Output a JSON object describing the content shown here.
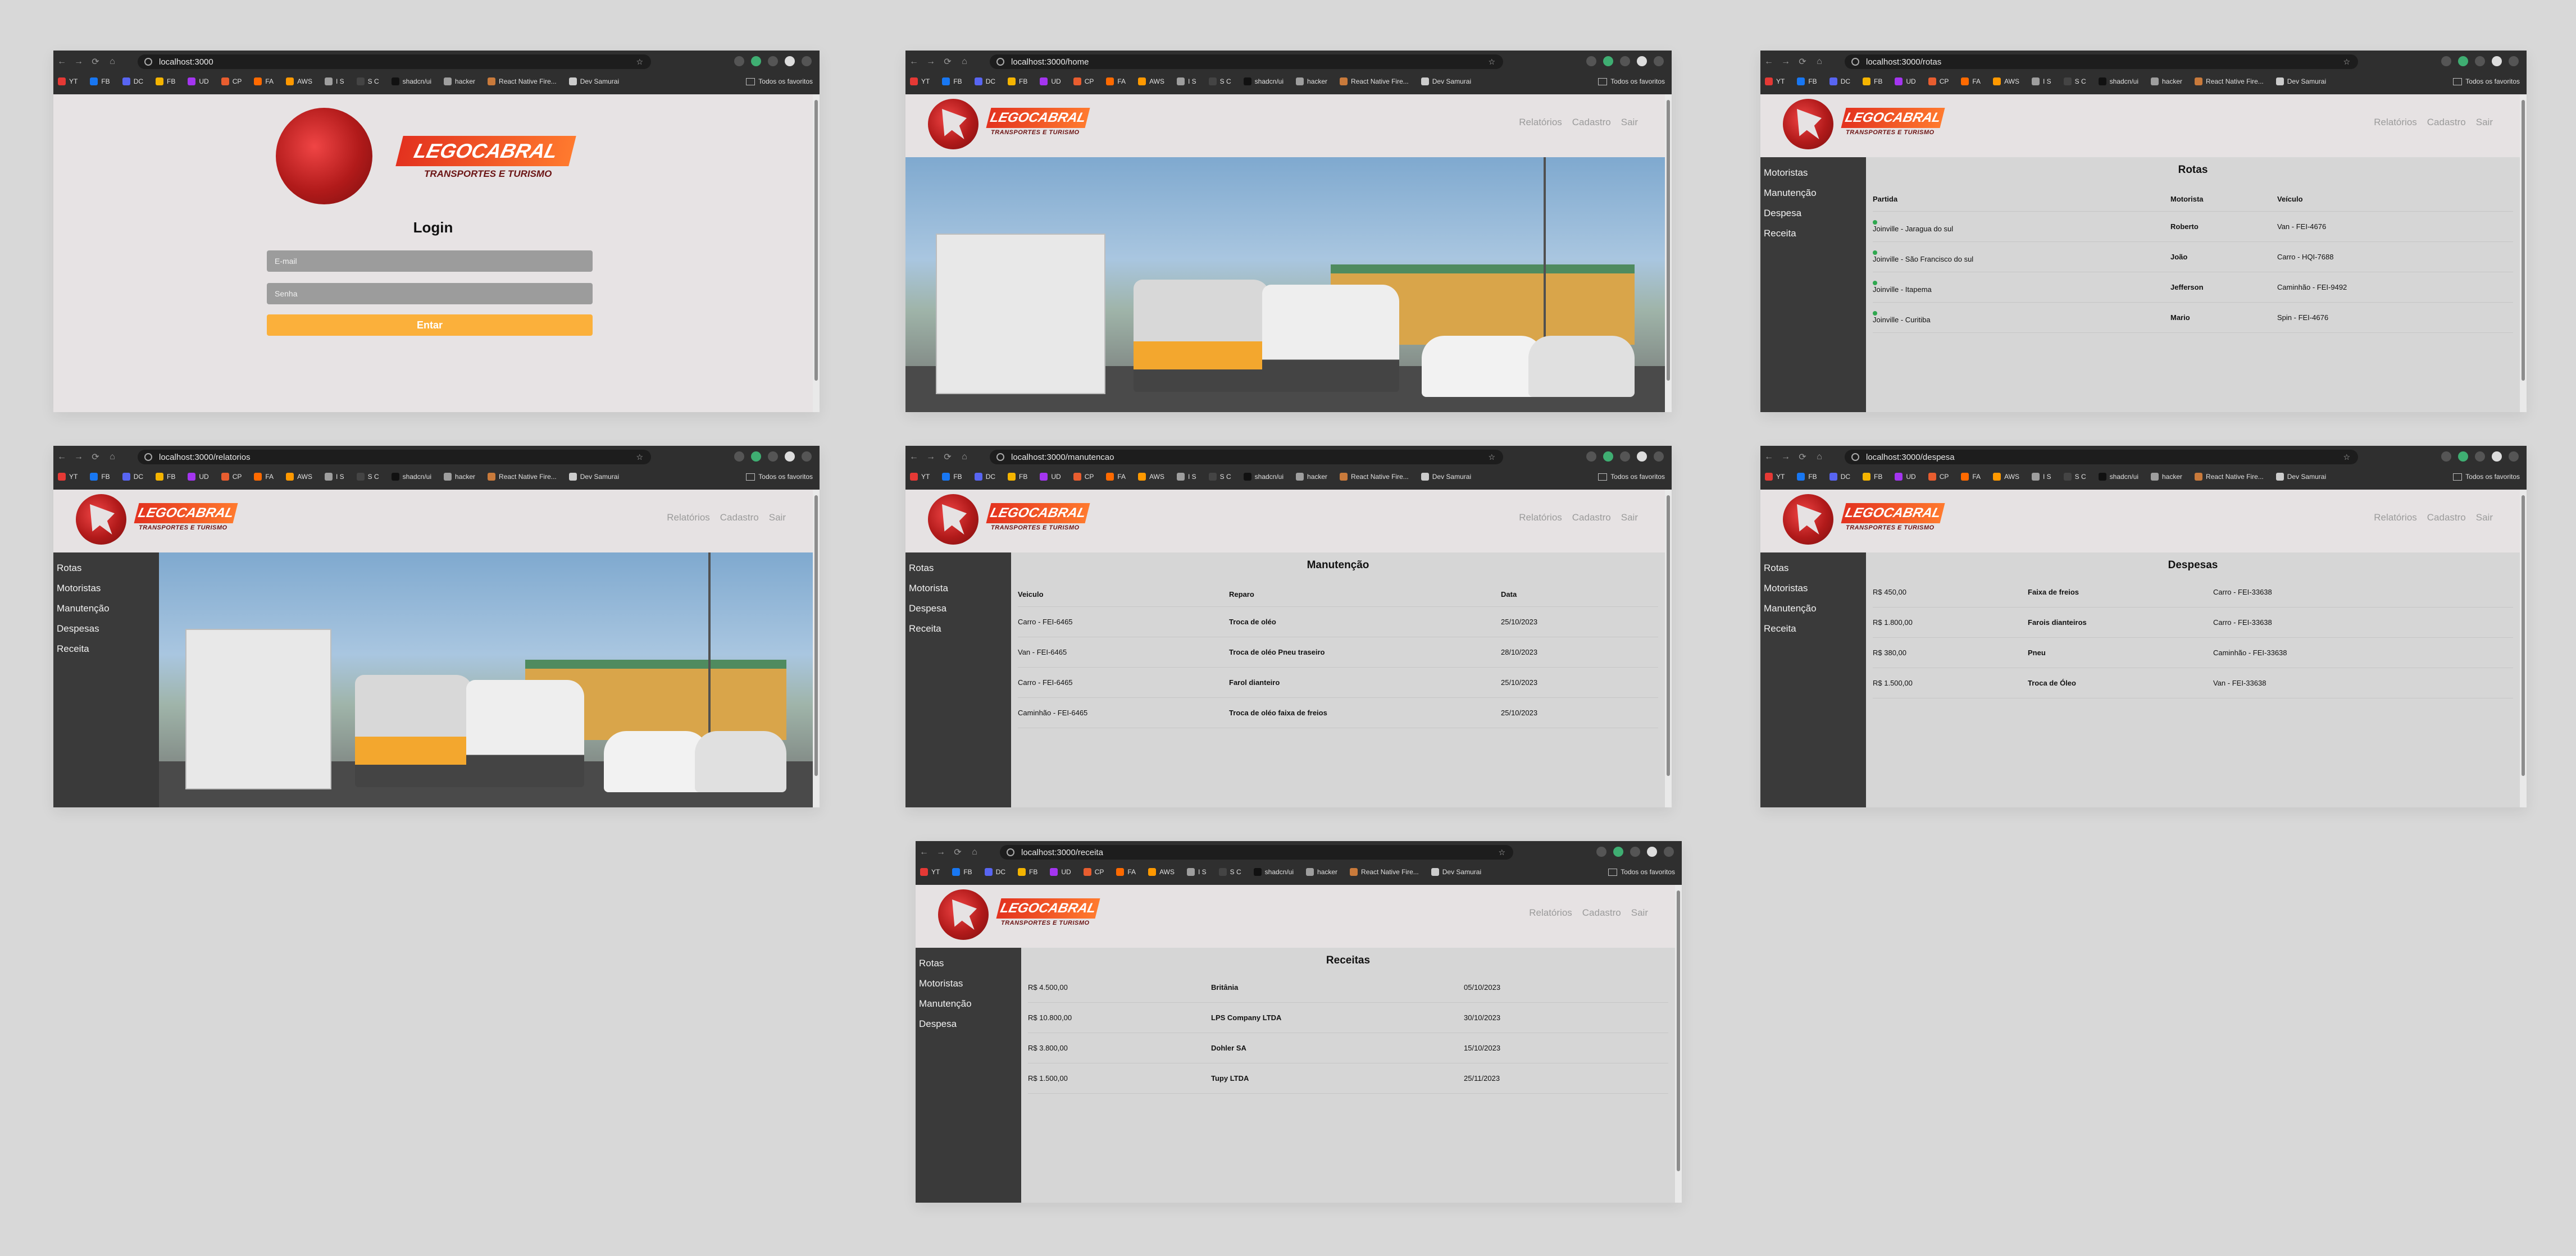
{
  "bookmarks": [
    {
      "label": "YT",
      "color": "#e53935"
    },
    {
      "label": "FB",
      "color": "#1877f2"
    },
    {
      "label": "DC",
      "color": "#5865f2"
    },
    {
      "label": "FB",
      "color": "#f4b400"
    },
    {
      "label": "UD",
      "color": "#a435f0"
    },
    {
      "label": "CP",
      "color": "#e85d2f"
    },
    {
      "label": "FA",
      "color": "#ff6a00"
    },
    {
      "label": "AWS",
      "color": "#ff9900"
    },
    {
      "label": "I S",
      "color": "#9e9e9e"
    },
    {
      "label": "S C",
      "color": "#444444"
    },
    {
      "label": "shadcn/ui",
      "color": "#111111"
    },
    {
      "label": "hacker",
      "color": "#9e9e9e"
    },
    {
      "label": "React Native Fire...",
      "color": "#c97a3b"
    },
    {
      "label": "Dev Samurai",
      "color": "#cccccc"
    }
  ],
  "all_bookmarks": "Todos os favoritos",
  "brand": {
    "name": "LEGOCABRAL",
    "tagline": "TRANSPORTES E TURISMO"
  },
  "nav": {
    "relatorios": "Relatórios",
    "cadastro": "Cadastro",
    "sair": "Sair"
  },
  "windows": {
    "login": {
      "url": "localhost:3000",
      "title": "Login",
      "email_placeholder": "E-mail",
      "password_placeholder": "Senha",
      "submit": "Entar"
    },
    "home": {
      "url": "localhost:3000/home"
    },
    "rotas": {
      "url": "localhost:3000/rotas",
      "menu": [
        "Motoristas",
        "Manutenção",
        "Despesa",
        "Receita"
      ],
      "title": "Rotas",
      "headers": [
        "Partida",
        "Motorista",
        "Veículo"
      ],
      "rows": [
        [
          "Joinville - Jaragua do sul",
          "Roberto",
          "Van - FEI-4676"
        ],
        [
          "Joinville - São Francisco do sul",
          "João",
          "Carro - HQI-7688"
        ],
        [
          "Joinville - Itapema",
          "Jefferson",
          "Caminhão - FEI-9492"
        ],
        [
          "Joinville - Curitiba",
          "Mario",
          "Spin - FEI-4676"
        ]
      ]
    },
    "relatorios": {
      "url": "localhost:3000/relatorios",
      "menu": [
        "Rotas",
        "Motoristas",
        "Manutenção",
        "Despesas",
        "Receita"
      ]
    },
    "manutencao": {
      "url": "localhost:3000/manutencao",
      "menu": [
        "Rotas",
        "Motorista",
        "Despesa",
        "Receita"
      ],
      "title": "Manutenção",
      "headers": [
        "Veiculo",
        "Reparo",
        "Data"
      ],
      "rows": [
        [
          "Carro - FEI-6465",
          "Troca de oléo",
          "25/10/2023"
        ],
        [
          "Van - FEI-6465",
          "Troca de oléo Pneu traseiro",
          "28/10/2023"
        ],
        [
          "Carro - FEI-6465",
          "Farol dianteiro",
          "25/10/2023"
        ],
        [
          "Caminhão - FEI-6465",
          "Troca de oléo faixa de freios",
          "25/10/2023"
        ]
      ]
    },
    "despesa": {
      "url": "localhost:3000/despesa",
      "menu": [
        "Rotas",
        "Motoristas",
        "Manutenção",
        "Receita"
      ],
      "title": "Despesas",
      "rows": [
        [
          "R$ 450,00",
          "Faixa de freios",
          "Carro - FEI-33638"
        ],
        [
          "R$ 1.800,00",
          "Farois dianteiros",
          "Carro - FEI-33638"
        ],
        [
          "R$ 380,00",
          "Pneu",
          "Caminhão - FEI-33638"
        ],
        [
          "R$ 1.500,00",
          "Troca de Óleo",
          "Van - FEI-33638"
        ]
      ]
    },
    "receita": {
      "url": "localhost:3000/receita",
      "menu": [
        "Rotas",
        "Motoristas",
        "Manutenção",
        "Despesa"
      ],
      "title": "Receitas",
      "rows": [
        [
          "R$ 4.500,00",
          "Britânia",
          "05/10/2023"
        ],
        [
          "R$ 10.800,00",
          "LPS Company LTDA",
          "30/10/2023"
        ],
        [
          "R$ 3.800,00",
          "Dohler SA",
          "15/10/2023"
        ],
        [
          "R$ 1.500,00",
          "Tupy LTDA",
          "25/11/2023"
        ]
      ]
    }
  }
}
